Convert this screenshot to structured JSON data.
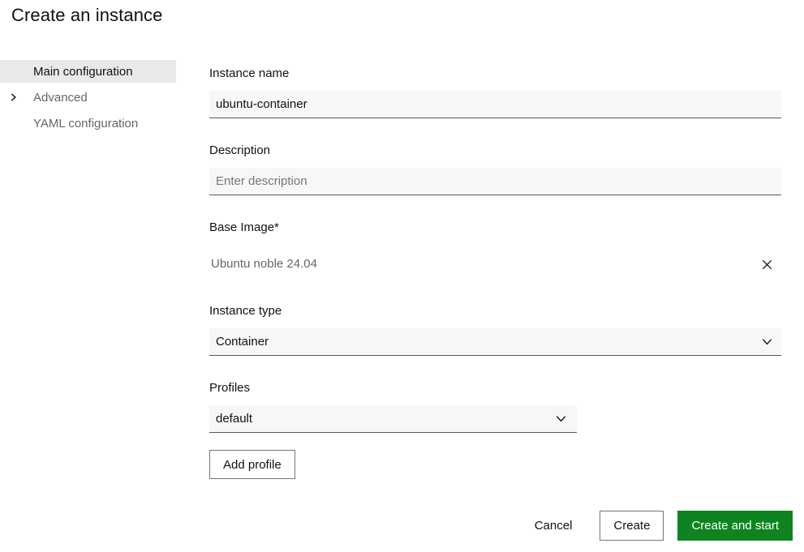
{
  "page": {
    "title": "Create an instance"
  },
  "sidebar": {
    "items": [
      {
        "label": "Main configuration",
        "active": true
      },
      {
        "label": "Advanced",
        "active": false,
        "chevron": "chevron-right"
      },
      {
        "label": "YAML configuration",
        "active": false
      }
    ]
  },
  "form": {
    "instance_name": {
      "label": "Instance name",
      "value": "ubuntu-container"
    },
    "description": {
      "label": "Description",
      "placeholder": "Enter description"
    },
    "base_image": {
      "label": "Base Image*",
      "value": "Ubuntu noble 24.04",
      "remove_icon": "x-icon"
    },
    "instance_type": {
      "label": "Instance type",
      "value": "Container"
    },
    "profiles": {
      "label": "Profiles",
      "value": "default"
    },
    "add_profile_label": "Add profile"
  },
  "footer": {
    "cancel_label": "Cancel",
    "create_label": "Create",
    "create_and_start_label": "Create and start"
  },
  "colors": {
    "accent_green": "#0e8420",
    "active_item_bg": "#e9e9e9",
    "input_bg": "#f7f7f7",
    "input_border": "#595959",
    "muted_text": "#666666"
  }
}
